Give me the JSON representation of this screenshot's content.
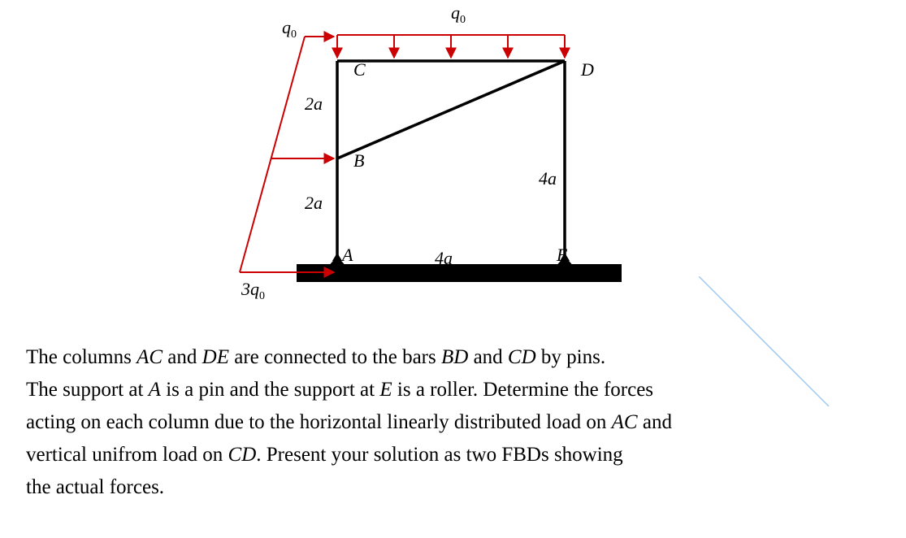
{
  "labels": {
    "q_top": "q",
    "q_top_sub": "0",
    "q_left": "q",
    "q_left_sub": "0",
    "q_bottom": "3q",
    "q_bottom_sub": "0",
    "seg_2a_upper": "2a",
    "seg_2a_lower": "2a",
    "seg_4a_side": "4a",
    "seg_4a_bottom": "4a",
    "A": "A",
    "B": "B",
    "C": "C",
    "D": "D",
    "E": "E"
  },
  "problem": {
    "p1a": "The columns ",
    "AC": "AC",
    "p1b": " and ",
    "DE": "DE",
    "p1c": " are connected to the bars ",
    "BD": "BD",
    "p1d": " and ",
    "CD": "CD",
    "p1e": " by pins.",
    "p2a": "The support at ",
    "A": "A",
    "p2b": " is a pin and the support at ",
    "E": "E",
    "p2c": " is a roller. Determine the forces",
    "p3a": "acting on each column due to the horizontal linearly distributed load on ",
    "AC2": "AC",
    "p3b": " and",
    "p4a": "vertical unifrom load on ",
    "CD2": "CD",
    "p4b": ". Present your solution as two FBDs showing",
    "p5": "the actual forces."
  }
}
